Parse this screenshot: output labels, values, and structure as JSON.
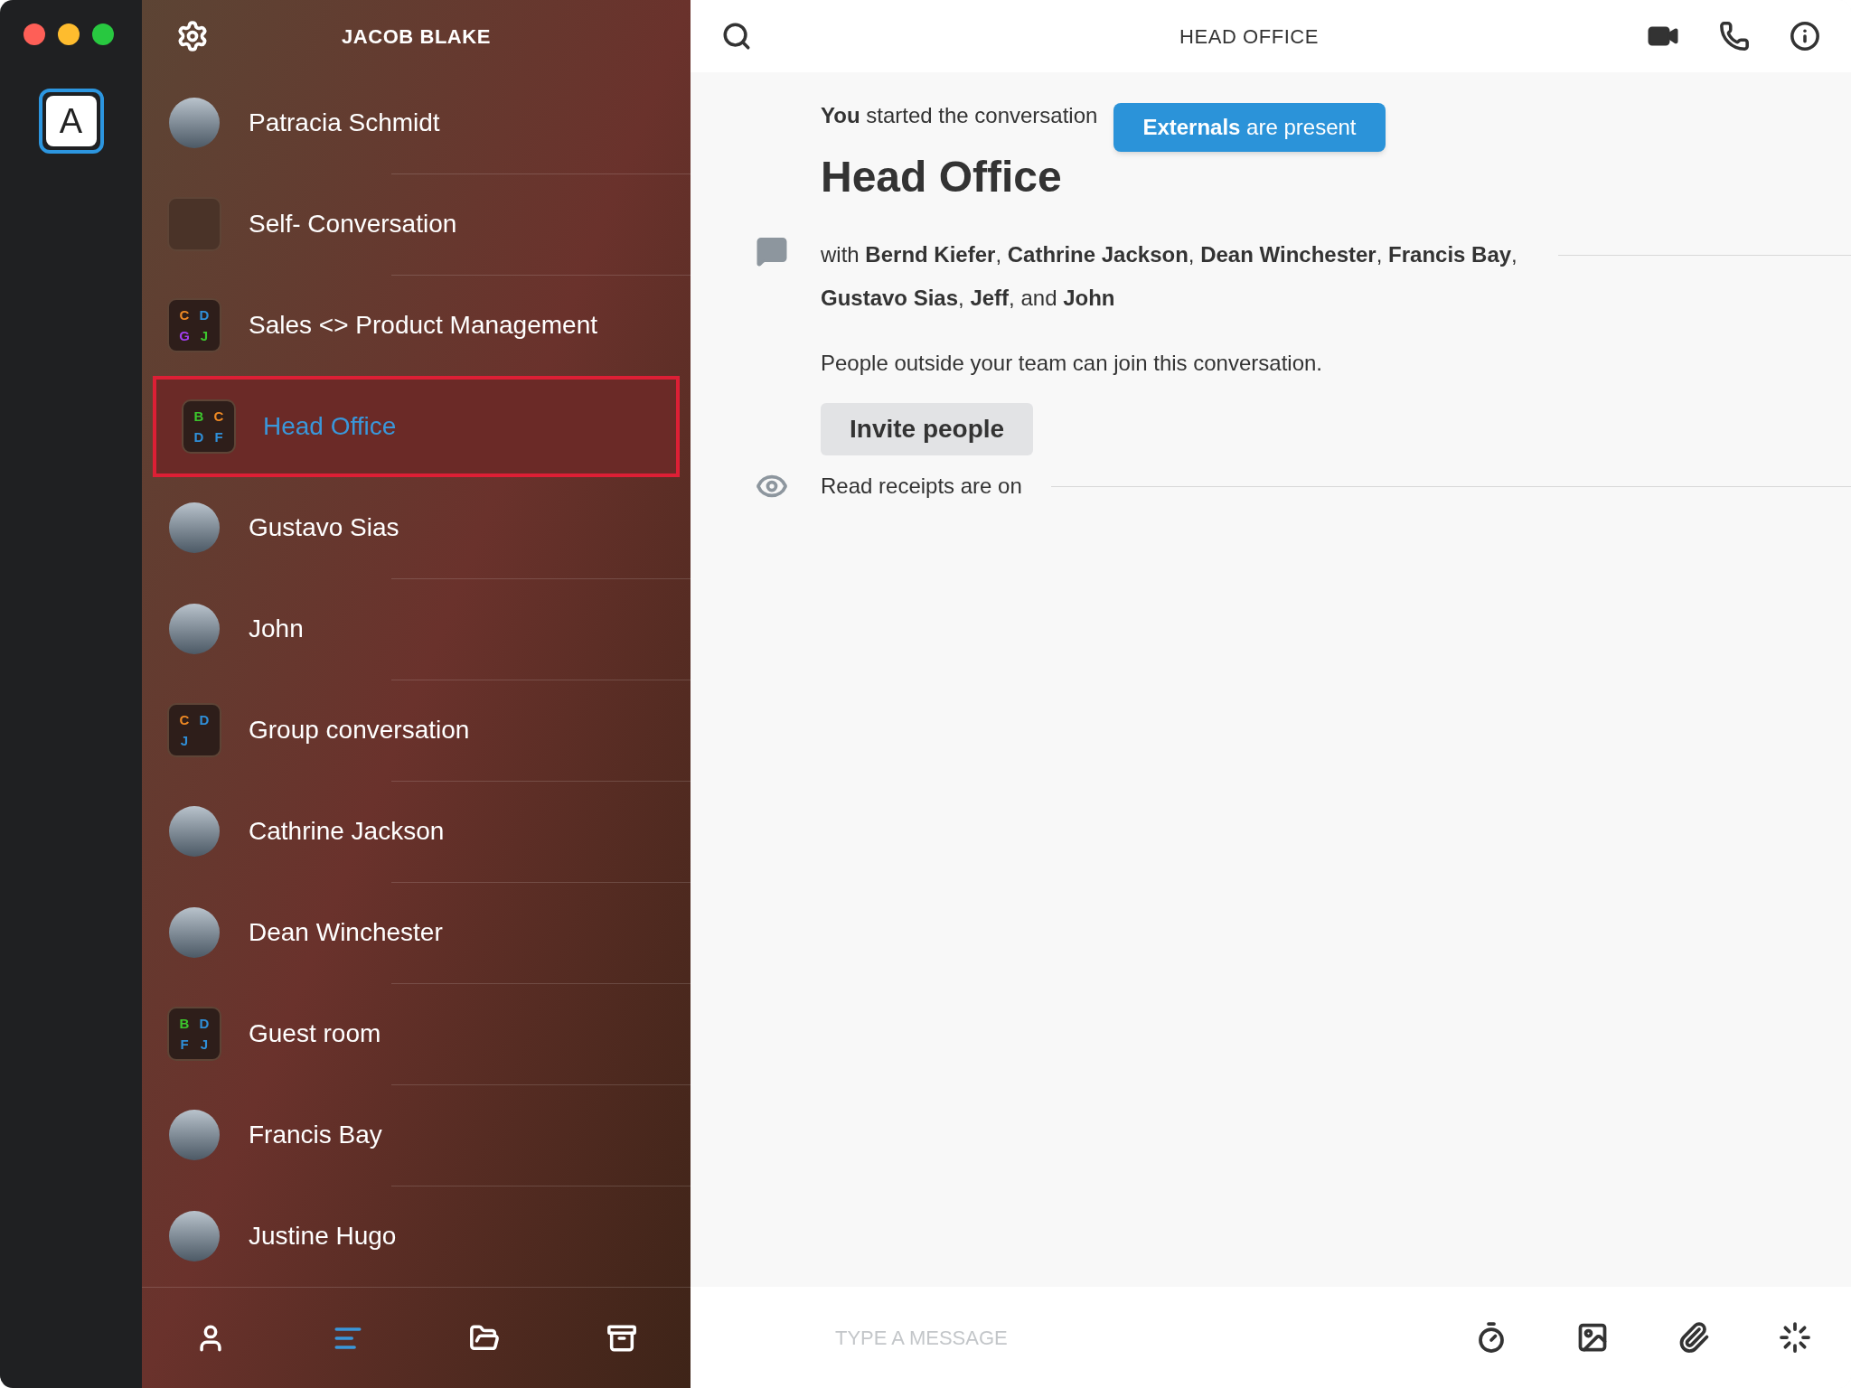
{
  "sidebar": {
    "account_initial": "A",
    "user_name": "JACOB BLAKE",
    "conversations": [
      {
        "kind": "photo",
        "name": "Patracia Schmidt",
        "selected": false
      },
      {
        "kind": "blank",
        "name": "Self- Conversation",
        "selected": false
      },
      {
        "kind": "group",
        "name": "Sales <> Product Management",
        "selected": false,
        "initials": [
          {
            "text": "C",
            "color": "#f08a24"
          },
          {
            "text": "D",
            "color": "#2f8fd8"
          },
          {
            "text": "G",
            "color": "#a23ef0"
          },
          {
            "text": "J",
            "color": "#3cc62d"
          }
        ]
      },
      {
        "kind": "group",
        "name": "Head Office",
        "selected": true,
        "initials": [
          {
            "text": "B",
            "color": "#3cc62d"
          },
          {
            "text": "C",
            "color": "#f08a24"
          },
          {
            "text": "D",
            "color": "#2f8fd8"
          },
          {
            "text": "F",
            "color": "#2f8fd8"
          }
        ]
      },
      {
        "kind": "photo",
        "name": "Gustavo Sias",
        "selected": false
      },
      {
        "kind": "photo",
        "name": "John",
        "selected": false
      },
      {
        "kind": "group",
        "name": "Group conversation",
        "selected": false,
        "initials": [
          {
            "text": "C",
            "color": "#f08a24"
          },
          {
            "text": "D",
            "color": "#2f8fd8"
          },
          {
            "text": "J",
            "color": "#2f8fd8"
          }
        ]
      },
      {
        "kind": "photo",
        "name": "Cathrine Jackson",
        "selected": false
      },
      {
        "kind": "photo",
        "name": "Dean Winchester",
        "selected": false
      },
      {
        "kind": "group",
        "name": "Guest room",
        "selected": false,
        "initials": [
          {
            "text": "B",
            "color": "#3cc62d"
          },
          {
            "text": "D",
            "color": "#2f8fd8"
          },
          {
            "text": "F",
            "color": "#2f8fd8"
          },
          {
            "text": "J",
            "color": "#2f8fd8"
          }
        ]
      },
      {
        "kind": "photo",
        "name": "Francis Bay",
        "selected": false
      },
      {
        "kind": "photo",
        "name": "Justine Hugo",
        "selected": false
      }
    ],
    "bottom_tabs": [
      {
        "kind": "people",
        "selected": false
      },
      {
        "kind": "conversations",
        "selected": true
      },
      {
        "kind": "folder",
        "selected": false
      },
      {
        "kind": "archive",
        "selected": false
      }
    ]
  },
  "header": {
    "title": "HEAD OFFICE"
  },
  "conversation": {
    "started": "**You** started the conversation",
    "externals_badge": "**Externals** are present",
    "title": "Head Office",
    "participants": "with **Bernd Kiefer**, **Cathrine Jackson**, **Dean Winchester**, **Francis Bay**, **Gustavo Sias**, **Jeff**, and **John**",
    "guest_notice": "People outside your team can join this conversation.",
    "invite_button": "Invite people",
    "read_receipts": "Read receipts are on"
  },
  "composer": {
    "placeholder": "TYPE A MESSAGE"
  }
}
